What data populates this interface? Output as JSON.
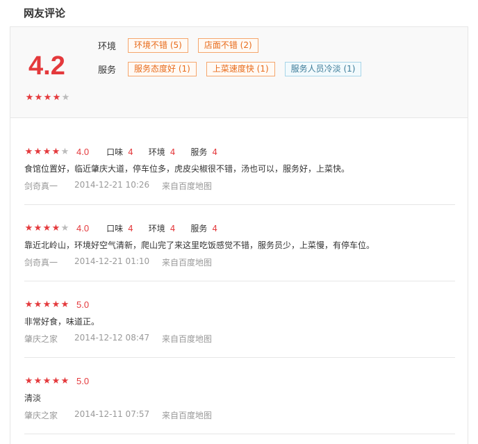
{
  "section_title": "网友评论",
  "summary": {
    "score": "4.2",
    "stars": 4,
    "rows": [
      {
        "label": "环境",
        "tags": [
          {
            "text": "环境不错 (5)",
            "kind": "pos"
          },
          {
            "text": "店面不错 (2)",
            "kind": "pos"
          }
        ]
      },
      {
        "label": "服务",
        "tags": [
          {
            "text": "服务态度好 (1)",
            "kind": "pos"
          },
          {
            "text": "上菜速度快 (1)",
            "kind": "pos"
          },
          {
            "text": "服务人员冷淡 (1)",
            "kind": "neg"
          }
        ]
      }
    ]
  },
  "reviews": [
    {
      "stars": 4,
      "score": "4.0",
      "subs": [
        {
          "label": "口味",
          "value": "4"
        },
        {
          "label": "环境",
          "value": "4"
        },
        {
          "label": "服务",
          "value": "4"
        }
      ],
      "text": "食馆位置好，临近肇庆大道，停车位多，虎皮尖椒很不错，汤也可以，服务好，上菜快。",
      "user": "剑奇真一",
      "time": "2014-12-21 10:26",
      "source": "来自百度地图"
    },
    {
      "stars": 4,
      "score": "4.0",
      "subs": [
        {
          "label": "口味",
          "value": "4"
        },
        {
          "label": "环境",
          "value": "4"
        },
        {
          "label": "服务",
          "value": "4"
        }
      ],
      "text": "靠近北岭山，环境好空气清新，爬山完了来这里吃饭感觉不错，服务员少，上菜慢，有停车位。",
      "user": "剑奇真一",
      "time": "2014-12-21 01:10",
      "source": "来自百度地图"
    },
    {
      "stars": 5,
      "score": "5.0",
      "subs": [],
      "text": "非常好食，味道正。",
      "user": "肇庆之家",
      "time": "2014-12-12 08:47",
      "source": "来自百度地图"
    },
    {
      "stars": 5,
      "score": "5.0",
      "subs": [],
      "text": "清淡",
      "user": "肇庆之家",
      "time": "2014-12-11 07:57",
      "source": "来自百度地图"
    }
  ],
  "colors": {
    "accent": "#e4393c",
    "tag_pos": "#e86b1a",
    "tag_neg": "#3d7c99",
    "meta": "#999999"
  }
}
